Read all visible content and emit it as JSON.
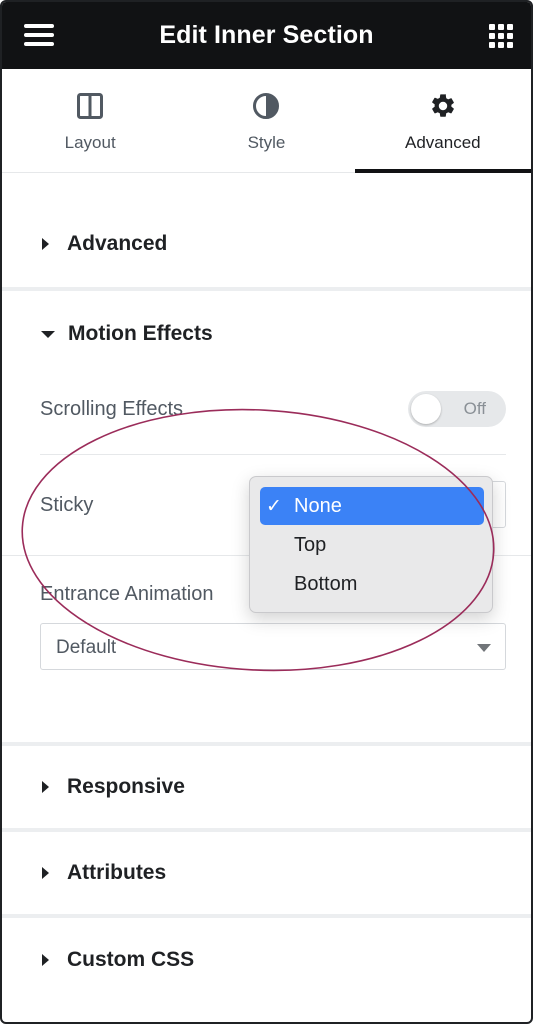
{
  "header": {
    "title": "Edit Inner Section"
  },
  "tabs": [
    {
      "label": "Layout",
      "icon": "columns-icon",
      "active": false
    },
    {
      "label": "Style",
      "icon": "half-circle-icon",
      "active": false
    },
    {
      "label": "Advanced",
      "icon": "gear-icon",
      "active": true
    }
  ],
  "sections": {
    "advanced": {
      "title": "Advanced",
      "expanded": false
    },
    "motion_effects": {
      "title": "Motion Effects",
      "expanded": true
    },
    "responsive": {
      "title": "Responsive",
      "expanded": false
    },
    "attributes": {
      "title": "Attributes",
      "expanded": false
    },
    "custom_css": {
      "title": "Custom CSS",
      "expanded": false
    }
  },
  "motion": {
    "scrolling_effects_label": "Scrolling Effects",
    "scrolling_effects_state": "Off",
    "sticky_label": "Sticky",
    "entrance_animation_label": "Entrance Animation",
    "entrance_animation_value": "Default"
  },
  "sticky_dropdown": {
    "options": [
      {
        "label": "None",
        "selected": true
      },
      {
        "label": "Top",
        "selected": false
      },
      {
        "label": "Bottom",
        "selected": false
      }
    ],
    "check_glyph": "✓"
  },
  "colors": {
    "header_bg": "#111214",
    "selected_option": "#3b82f6",
    "annotation": "#9b2c5a"
  }
}
